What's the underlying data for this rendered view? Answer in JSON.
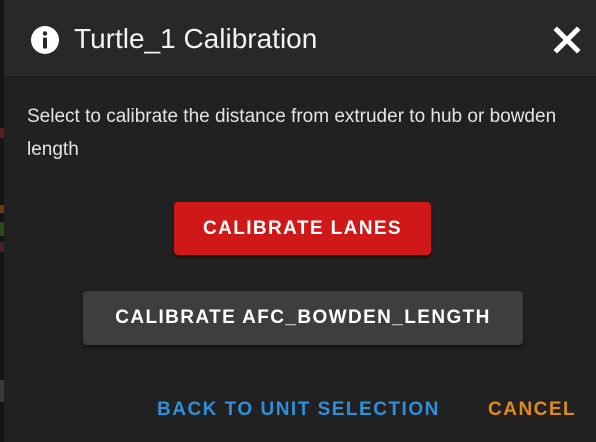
{
  "dialog": {
    "title": "Turtle_1 Calibration",
    "header_icon": "info-icon",
    "close_icon": "close-icon",
    "message": "Select to calibrate the distance from extruder to hub or bowden length"
  },
  "actions": {
    "calibrate_lanes_label": "CALIBRATE LANES",
    "calibrate_bowden_label": "CALIBRATE AFC_BOWDEN_LENGTH"
  },
  "footer": {
    "back_label": "BACK TO UNIT SELECTION",
    "cancel_label": "CANCEL"
  },
  "colors": {
    "dialog_background": "#212121",
    "header_background": "#282828",
    "primary_button": "#d01818",
    "secondary_button": "#3e3e3e",
    "back_link": "#2f8fd8",
    "cancel_link": "#e08a1e"
  }
}
